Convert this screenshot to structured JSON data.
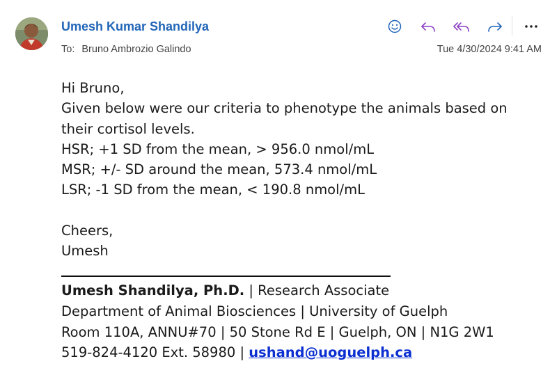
{
  "header": {
    "sender_name": "Umesh Kumar Shandilya",
    "to_label": "To:",
    "recipient": "Bruno Ambrozio Galindo",
    "datetime": "Tue 4/30/2024 9:41 AM"
  },
  "actions": [
    {
      "name": "emoji-reaction",
      "icon": "smiley-icon"
    },
    {
      "name": "reply",
      "icon": "reply-icon"
    },
    {
      "name": "reply-all",
      "icon": "reply-all-icon"
    },
    {
      "name": "forward",
      "icon": "forward-icon"
    },
    {
      "name": "more",
      "icon": "more-icon"
    }
  ],
  "colors": {
    "sender": "#2266b8",
    "action_icon_purple": "#8a3fc7",
    "action_icon_blue": "#2266b8",
    "link": "#0b2fd1"
  },
  "body": {
    "greeting": "Hi Bruno,",
    "line1": "Given below were our criteria to phenotype the animals based on",
    "line2": "their cortisol levels.",
    "hsr": "HSR; +1 SD from the mean, > 956.0 nmol/mL",
    "msr": "MSR; +/- SD around the mean, 573.4 nmol/mL",
    "lsr": "LSR; -1 SD from the mean, < 190.8 nmol/mL",
    "closing": "Cheers,",
    "name": "Umesh"
  },
  "signature": {
    "name": "Umesh Shandilya, Ph.D.",
    "title_sep": " | Research Associate",
    "dept_line": "Department of Animal Biosciences | University of Guelph",
    "address_line": "Room 110A, ANNU#70 | 50 Stone Rd E | Guelph, ON | N1G 2W1",
    "phone": "519-824-4120 Ext. 58980 | ",
    "email": "ushand@uoguelph.ca"
  }
}
